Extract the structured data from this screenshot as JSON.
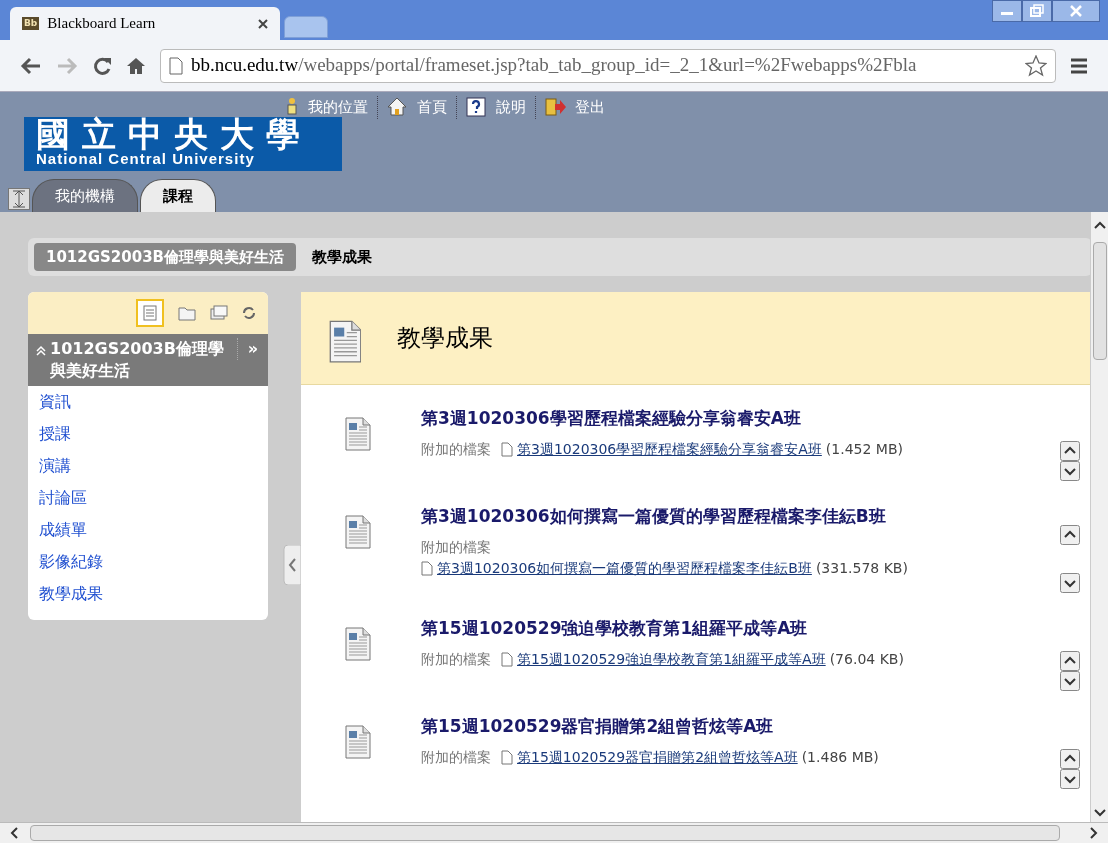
{
  "browser": {
    "tab_title": "Blackboard Learn",
    "favicon": "Bb",
    "url_host": "bb.ncu.edu.tw",
    "url_path": "/webapps/portal/frameset.jsp?tab_tab_group_id=_2_1&url=%2Fwebapps%2Fbla"
  },
  "header": {
    "logo_title": "國立中央大學",
    "logo_subtitle": "National Central University",
    "links": [
      {
        "kind": "person",
        "label": "我的位置"
      },
      {
        "kind": "home",
        "label": "首頁"
      },
      {
        "kind": "help",
        "label": "說明"
      },
      {
        "kind": "logout",
        "label": "登出"
      }
    ],
    "tabs": [
      {
        "label": "我的機構",
        "selected": false
      },
      {
        "label": "課程",
        "selected": true
      }
    ]
  },
  "breadcrumb": [
    {
      "label": "1012GS2003B倫理學與美好生活",
      "kind": "course"
    },
    {
      "label": "教學成果",
      "kind": "current"
    }
  ],
  "course_menu": {
    "title": "1012GS2003B倫理學與美好生活",
    "expand": "»",
    "items": [
      {
        "label": "資訊"
      },
      {
        "label": "授課"
      },
      {
        "label": "演講"
      },
      {
        "label": "討論區"
      },
      {
        "label": "成績單"
      },
      {
        "label": "影像紀錄"
      },
      {
        "label": "教學成果"
      }
    ]
  },
  "content": {
    "title": "教學成果",
    "items": [
      {
        "title": "第3週1020306學習歷程檔案經驗分享翁睿安A班",
        "attachment_label": "附加的檔案",
        "file": "第3週1020306學習歷程檔案經驗分享翁睿安A班",
        "size": "(1.452 MB)",
        "kind": "inline"
      },
      {
        "title": "第3週1020306如何撰寫一篇優質的學習歷程檔案李佳紜B班",
        "attachment_label": "附加的檔案",
        "file": "第3週1020306如何撰寫一篇優質的學習歷程檔案李佳紜B班",
        "size": "(331.578 KB)",
        "kind": "stacked"
      },
      {
        "title": "第15週1020529強迫學校教育第1組羅平成等A班",
        "attachment_label": "附加的檔案",
        "file": "第15週1020529強迫學校教育第1組羅平成等A班",
        "size": "(76.04 KB)",
        "kind": "inline"
      },
      {
        "title": "第15週1020529器官捐贈第2組曾哲炫等A班",
        "attachment_label": "附加的檔案",
        "file": "第15週1020529器官捐贈第2組曾哲炫等A班",
        "size": "(1.486 MB)",
        "kind": "inline"
      }
    ]
  }
}
